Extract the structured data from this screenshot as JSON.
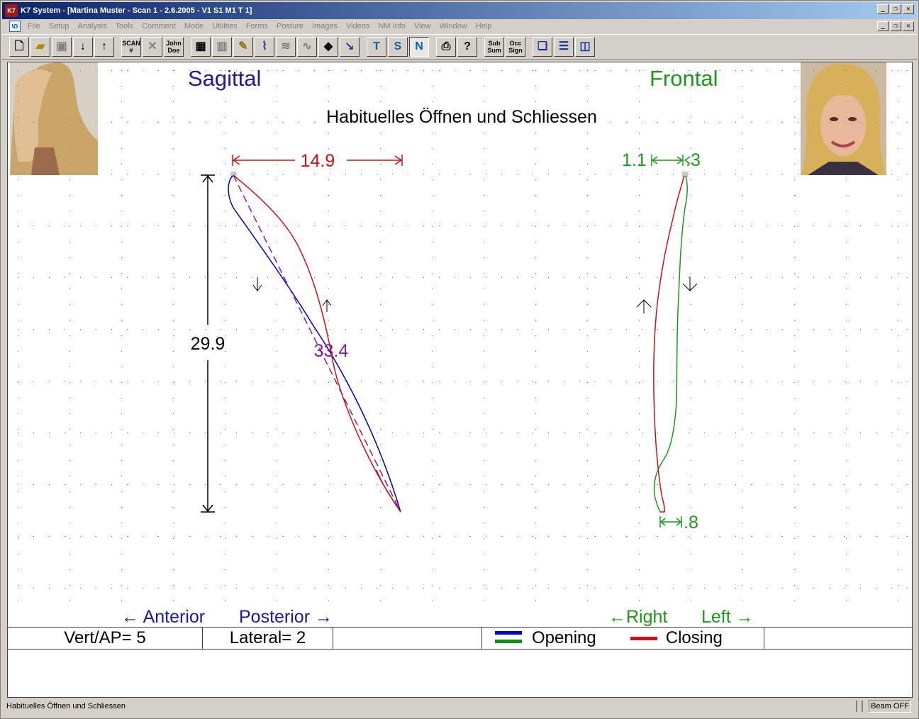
{
  "window": {
    "title": "K7 System - [Martina Muster - Scan 1 - 2.6.2005 - V1 S1   M1  T 1]",
    "app_icon": "K7"
  },
  "menu": {
    "mdi_icon": "\\O",
    "items": [
      "File",
      "Setup",
      "Analysis",
      "Tools",
      "Comment",
      "Mode",
      "Utilities",
      "Forms",
      "Posture",
      "Images",
      "Videos",
      "NM Info",
      "View",
      "Window",
      "Help"
    ]
  },
  "toolbar": {
    "scan_label": "SCAN #",
    "patient_label": "John Doe",
    "sub_sum_label": "Sub Sum",
    "occ_sign_label": "Occ Sign"
  },
  "plot": {
    "title": "Habituelles Öffnen und Schliessen",
    "sagittal_label": "Sagittal",
    "frontal_label": "Frontal",
    "sagittal_horizontal": "14.9",
    "sagittal_vertical": "29.9",
    "sagittal_diagonal": "33.4",
    "frontal_left_top": "1.1",
    "frontal_right_top": ".3",
    "frontal_bottom": ".8",
    "anterior_label": "← Anterior",
    "posterior_label": "Posterior →",
    "right_label": "←Right",
    "left_label": "Left →",
    "colors": {
      "opening_sagittal": "#0000c0",
      "opening_frontal": "#109010",
      "closing": "#d01010",
      "diagonal": "#8a1a9a",
      "sagittal_title": "#1a1aa0",
      "frontal_title": "#1a9a1a"
    }
  },
  "legend": {
    "vert_ap": "Vert/AP= 5",
    "lateral": "Lateral= 2",
    "opening": "Opening",
    "closing": "Closing"
  },
  "status": {
    "text": "Habituelles Öffnen und Schliessen",
    "beam": "Beam OFF"
  }
}
